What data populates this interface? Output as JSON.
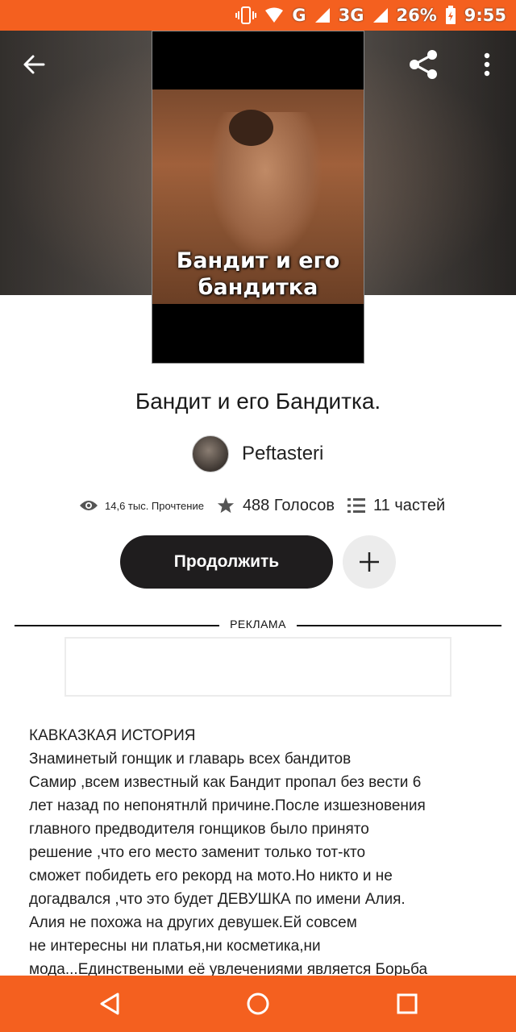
{
  "status_bar": {
    "battery": "26%",
    "network": "3G",
    "signal_label": "G",
    "time": "9:55"
  },
  "cover": {
    "title_line1": "Бандит и его",
    "title_line2": "бандитка"
  },
  "story": {
    "title": "Бандит и его Бандитка.",
    "author": "Peftasteri"
  },
  "stats": {
    "reads": "14,6 тыс. Прочтение",
    "votes": "488 Голосов",
    "parts": "11 частей"
  },
  "actions": {
    "continue_label": "Продолжить"
  },
  "ad": {
    "label": "РЕКЛАМА"
  },
  "description": "КАВКАЗКАЯ ИСТОРИЯ\nЗнаминетый гонщик и главарь всех бандитов\nСамир ,всем известный как Бандит пропал без вести 6\nлет назад по непонятнлй причине.После  изшезновения\nглавного предводителя гонщиков было принято\nрешение ,что его место заменит только тот-кто\nсможет побидеть его рекорд  на мото.Но никто и не\nдогадвался ,что это будет ДЕВУШКА по имени Алия.\nАлия не похожа на других девушек.Ей совсем\nне интересны ни платья,ни косметика,ни\nмода...Единствеными её увлечениями является Борьба",
  "colors": {
    "accent": "#f4601f",
    "button_dark": "#1f1d1e"
  },
  "icons": [
    "back-arrow-icon",
    "share-icon",
    "more-vert-icon",
    "eye-icon",
    "star-icon",
    "list-icon",
    "plus-icon",
    "nav-back-icon",
    "nav-home-icon",
    "nav-recents-icon"
  ]
}
